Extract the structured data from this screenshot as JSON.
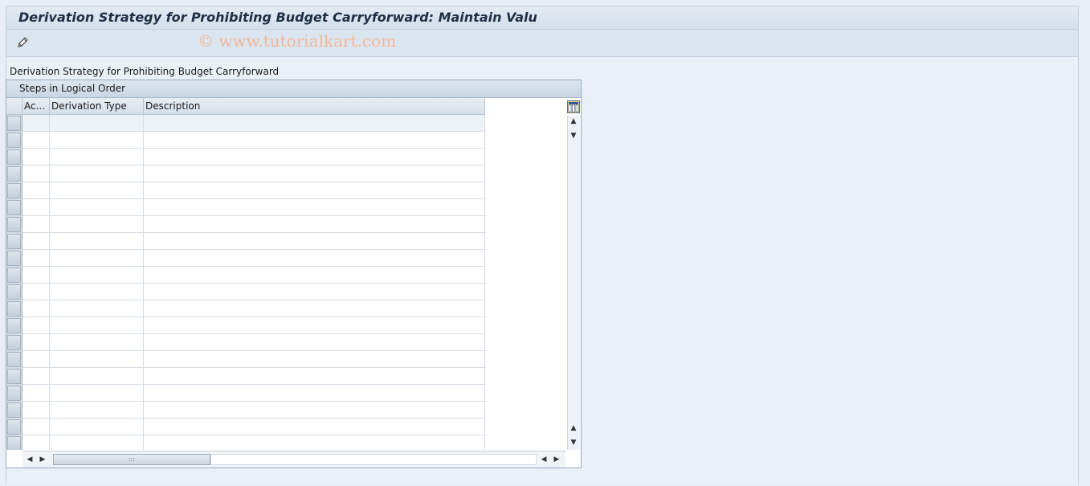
{
  "window": {
    "title": "Derivation Strategy for Prohibiting Budget Carryforward: Maintain Valu"
  },
  "toolbar": {
    "edit_icon": "pencil-icon",
    "watermark": "© www.tutorialkart.com"
  },
  "main": {
    "section_label": "Derivation Strategy for Prohibiting Budget Carryforward",
    "table": {
      "title": "Steps in Logical Order",
      "columns": [
        "Ac...",
        "Derivation Type",
        "Description"
      ],
      "row_count": 20,
      "rows": []
    }
  },
  "colors": {
    "background": "#e8eef5",
    "title_bar": "#d3dfeb",
    "header_cell": "#d7e0e9",
    "watermark": "#efb89b"
  }
}
